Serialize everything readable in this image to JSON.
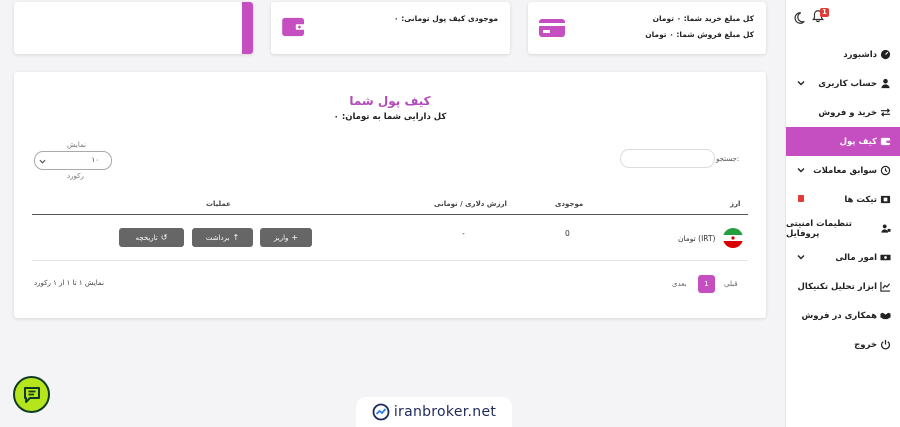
{
  "header": {
    "notification_count": "1"
  },
  "sidebar": {
    "items": [
      {
        "label": "داشبورد",
        "icon": "dashboard-icon"
      },
      {
        "label": "حساب کاربری",
        "icon": "user-icon",
        "expandable": true
      },
      {
        "label": "خرید و فروش",
        "icon": "exchange-icon"
      },
      {
        "label": "کیف پول",
        "icon": "wallet-icon",
        "active": true
      },
      {
        "label": "سوابق معاملات",
        "icon": "history-icon",
        "expandable": true
      },
      {
        "label": "تیکت ها",
        "icon": "ticket-icon",
        "has_badge": true
      },
      {
        "label": "تنظیمات امنیتی پروفایل",
        "icon": "user-lock-icon"
      },
      {
        "label": "امور مالی",
        "icon": "money-icon",
        "expandable": true
      },
      {
        "label": "ابزار تحلیل تکنیکال",
        "icon": "chart-icon"
      },
      {
        "label": "همکاری در فروش",
        "icon": "handshake-icon"
      },
      {
        "label": "خروج",
        "icon": "power-icon"
      }
    ]
  },
  "stats": {
    "total_buy": "کل مبلغ خرید شما: ۰ تومان",
    "total_sell": "کل مبلغ فروش شما: ۰ تومان",
    "wallet_balance": "موجودی کیف پول تومانی: ۰"
  },
  "wallet": {
    "title": "کیف پول شما",
    "subtitle": "کل دارایی شما به تومان: ۰",
    "show_label": "نمایش",
    "show_value": "۱۰",
    "record_label": "رکورد",
    "search_label": "جستجو:",
    "search_value": ""
  },
  "table": {
    "headers": {
      "currency": "ارز",
      "balance": "موجودی",
      "dollar_value": "ارزش دلاری / تومانی",
      "operations": "عملیات"
    },
    "rows": [
      {
        "currency": "تومان (IRT)",
        "balance": "0",
        "dollar_value": "-",
        "deposit": "واریز",
        "withdraw": "برداشت",
        "history": "تاریخچه"
      }
    ],
    "info": "نمایش ۱ تا ۱ از ۱ رکورد",
    "pagination": {
      "prev": "قبلی",
      "current": "1",
      "next": "بعدی"
    }
  },
  "footer": {
    "logo_text": "iranbroker.net"
  },
  "colors": {
    "accent": "#c54fc0",
    "button": "#666666",
    "chat": "#b5e61d"
  }
}
